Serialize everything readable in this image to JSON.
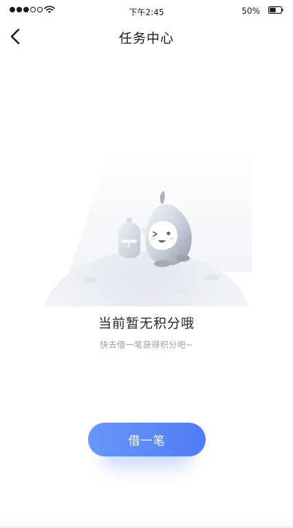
{
  "status_bar": {
    "time": "下午2:45",
    "battery_percent": "50%",
    "signal_bars_filled": 3,
    "signal_bars_total": 5,
    "battery_level": 0.5
  },
  "nav": {
    "title": "任务中心",
    "back_icon": "chevron-left-icon"
  },
  "empty_state": {
    "title": "当前暂无积分哦",
    "subtitle": "快去借一笔获得积分吧~",
    "illustration": "mascot-empty-illustration"
  },
  "actions": {
    "borrow_label": "借一笔"
  },
  "colors": {
    "accent_start": "#6798fb",
    "accent_end": "#4f7cf4",
    "title_text": "#222633",
    "subtitle_text": "#9aa0ab"
  }
}
